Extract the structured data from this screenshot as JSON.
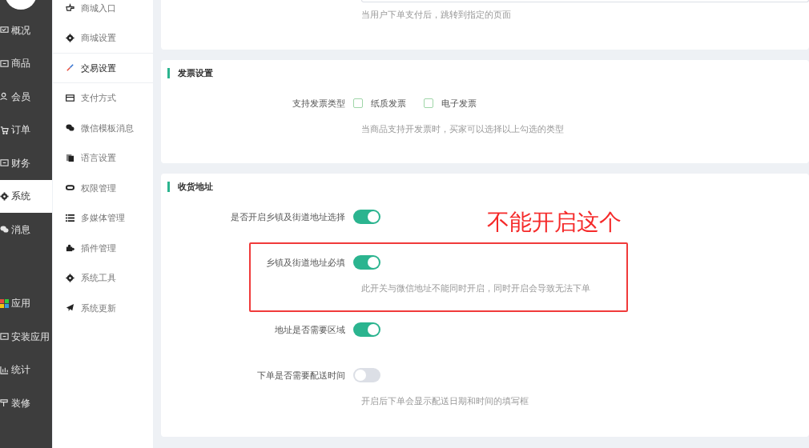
{
  "primary_nav": {
    "groups": [
      {
        "items": [
          {
            "label": "概况",
            "selected": false
          },
          {
            "label": "商品",
            "selected": false
          },
          {
            "label": "会员",
            "selected": false
          },
          {
            "label": "订单",
            "selected": false
          },
          {
            "label": "财务",
            "selected": false
          },
          {
            "label": "系统",
            "selected": true
          },
          {
            "label": "消息",
            "selected": false
          }
        ]
      },
      {
        "items": [
          {
            "label": "应用",
            "selected": false
          },
          {
            "label": "安装应用",
            "selected": false
          },
          {
            "label": "统计",
            "selected": false
          },
          {
            "label": "装修",
            "selected": false
          }
        ]
      }
    ]
  },
  "secondary_nav": {
    "items": [
      {
        "label": "商城入口",
        "selected": false
      },
      {
        "label": "商城设置",
        "selected": false
      },
      {
        "label": "交易设置",
        "selected": true
      },
      {
        "label": "支付方式",
        "selected": false
      },
      {
        "label": "微信模板消息",
        "selected": false
      },
      {
        "label": "语言设置",
        "selected": false
      },
      {
        "label": "权限管理",
        "selected": false
      },
      {
        "label": "多媒体管理",
        "selected": false
      },
      {
        "label": "插件管理",
        "selected": false
      },
      {
        "label": "系统工具",
        "selected": false
      },
      {
        "label": "系统更新",
        "selected": false
      }
    ]
  },
  "sections": [
    {
      "hint": "当用户下单支付后，跳转到指定的页面"
    },
    {
      "title": "发票设置",
      "rows": [
        {
          "kind": "checkboxes",
          "label": "支持发票类型",
          "options": [
            {
              "label": "纸质发票",
              "checked": false
            },
            {
              "label": "电子发票",
              "checked": false
            }
          ],
          "hint": "当商品支持开发票时，买家可以选择以上勾选的类型"
        }
      ]
    },
    {
      "title": "收货地址",
      "rows": [
        {
          "kind": "toggle",
          "label": "是否开启乡镇及街道地址选择",
          "on": true
        },
        {
          "kind": "toggle",
          "label": "乡镇及街道地址必填",
          "on": true,
          "hint": "此开关与微信地址不能同时开启，同时开启会导致无法下单",
          "annotation": "不能开启这个"
        },
        {
          "kind": "toggle",
          "label": "地址是否需要区域",
          "on": true
        },
        {
          "kind": "toggle",
          "label": "下单是否需要配送时间",
          "on": false,
          "hint": "开启后下单会显示配送日期和时间的填写框"
        }
      ]
    }
  ]
}
